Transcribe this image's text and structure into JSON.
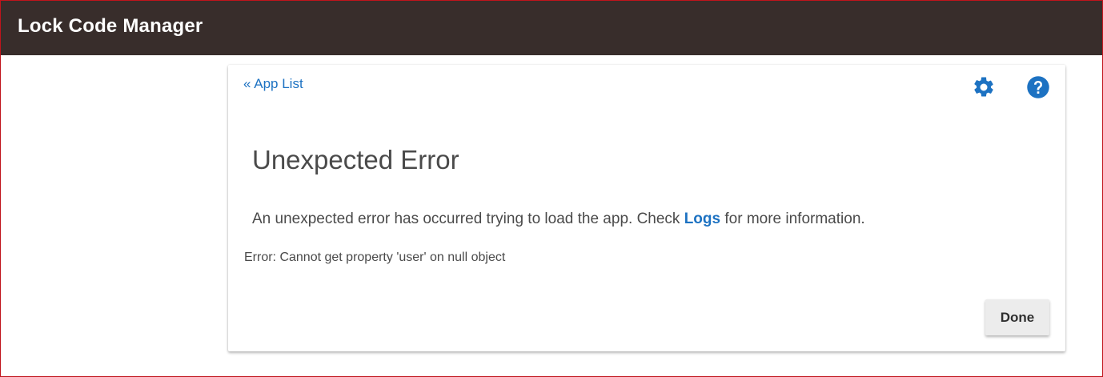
{
  "header": {
    "title": "Lock Code Manager"
  },
  "card": {
    "back_link": "« App List",
    "icons": {
      "settings": "gear-icon",
      "help": "help-icon"
    },
    "error_title": "Unexpected Error",
    "message_before": "An unexpected error has occurred trying to load the app. Check ",
    "logs_link": "Logs",
    "message_after": " for more information.",
    "error_detail": "Error: Cannot get property 'user' on null object",
    "done_label": "Done"
  },
  "colors": {
    "header_bg": "#382d2b",
    "link": "#1d72c2",
    "frame_border": "#c0141c",
    "button_bg": "#ececec"
  }
}
